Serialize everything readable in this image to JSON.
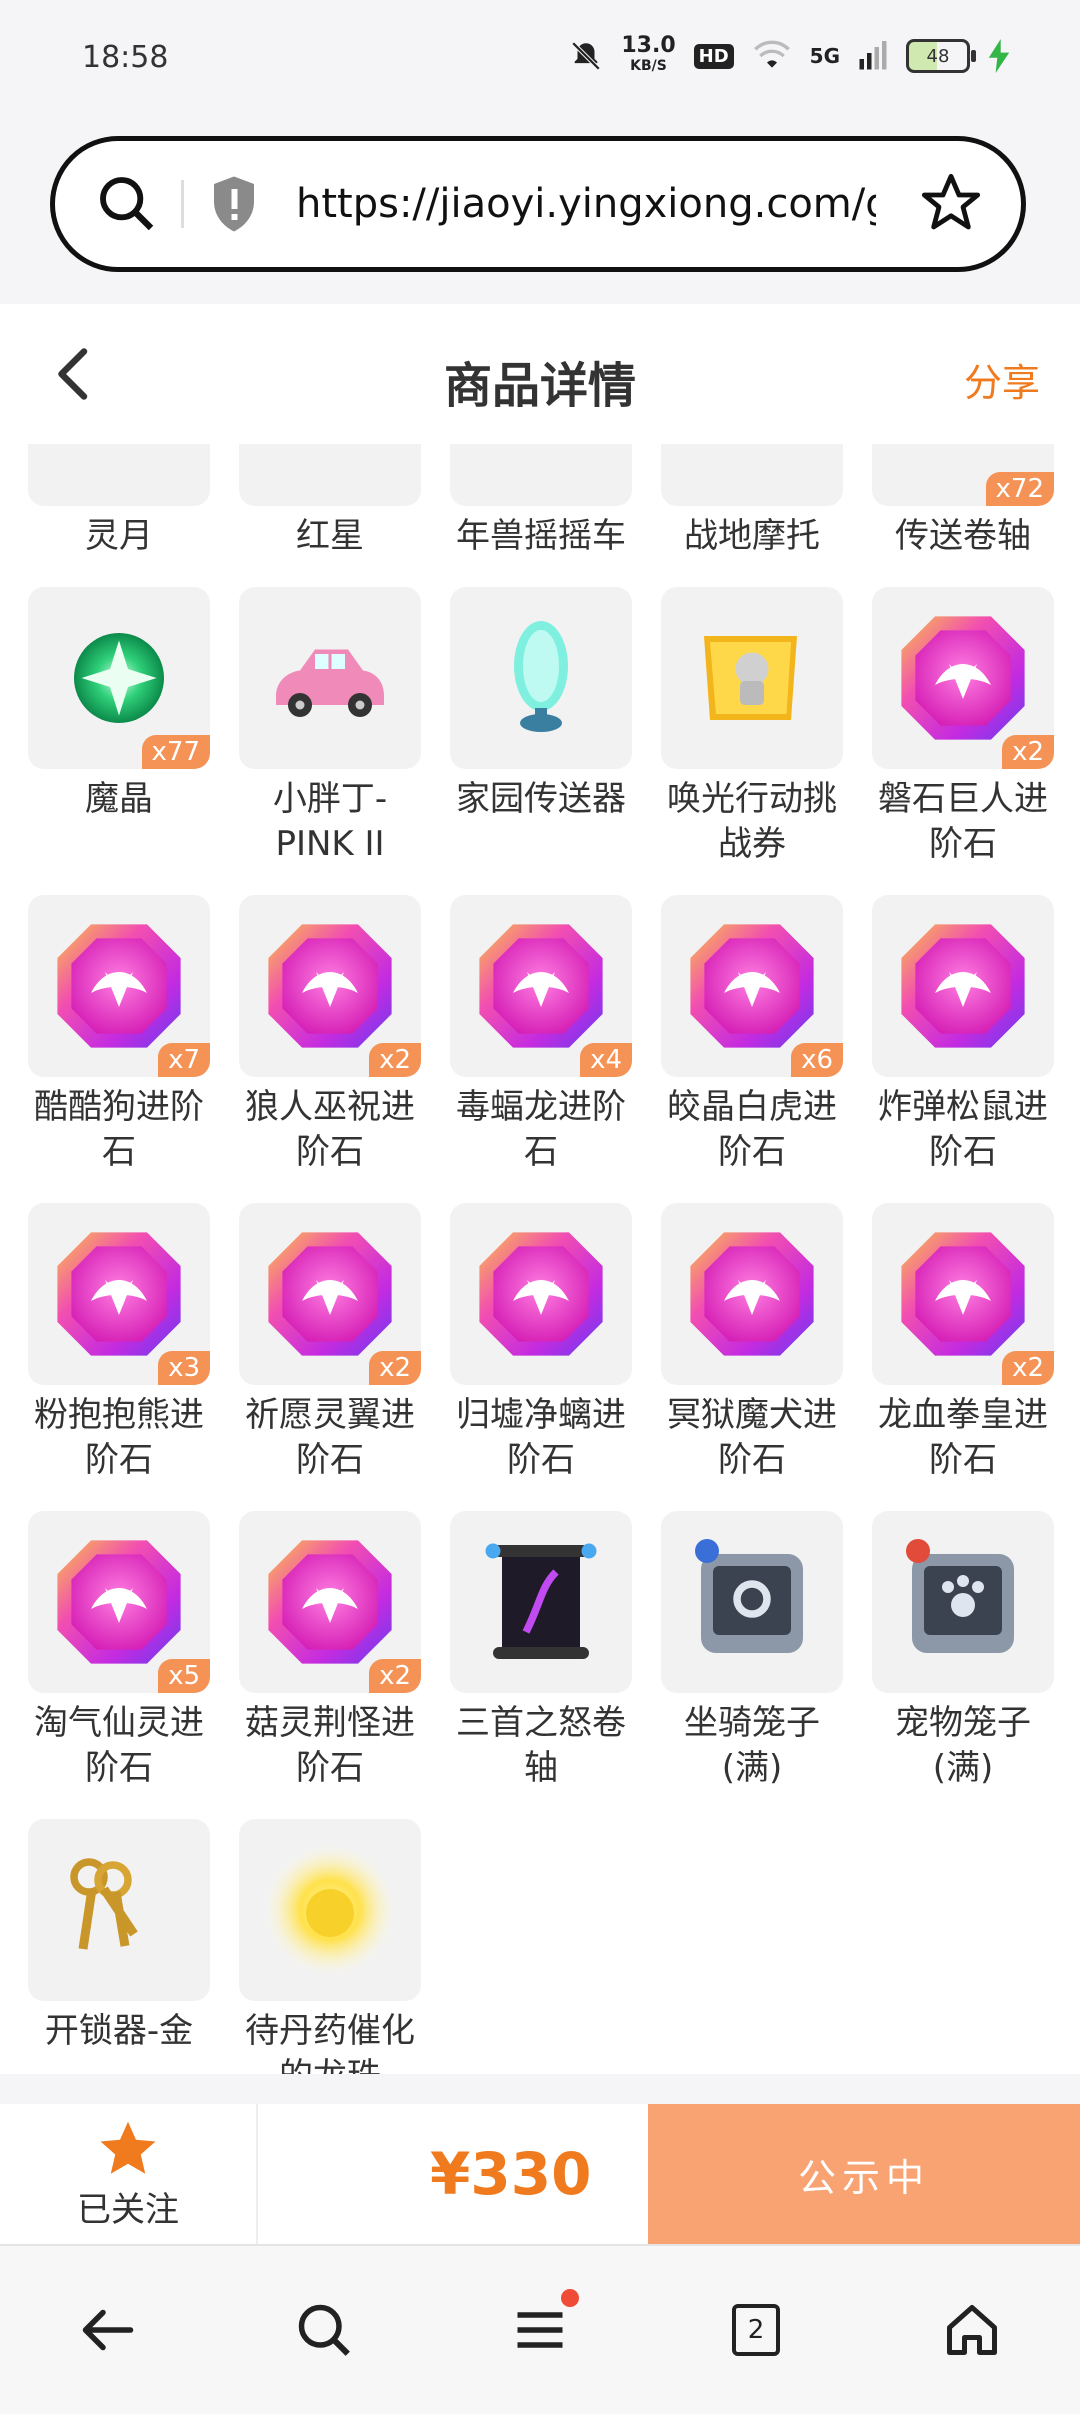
{
  "status": {
    "time": "18:58",
    "netspeed_value": "13.0",
    "netspeed_unit": "KB/S",
    "hd": "HD",
    "network": "5G",
    "battery": "48"
  },
  "browser": {
    "url": "https://jiaoyi.yingxiong.com/g ..."
  },
  "header": {
    "title": "商品详情",
    "share": "分享"
  },
  "items": [
    {
      "label": "灵月",
      "badge": "",
      "kind": "moon"
    },
    {
      "label": "红星",
      "badge": "",
      "kind": "ring"
    },
    {
      "label": "年兽摇摇车",
      "badge": "",
      "kind": "cart"
    },
    {
      "label": "战地摩托",
      "badge": "",
      "kind": "moto"
    },
    {
      "label": "传送卷轴",
      "badge": "x72",
      "kind": "scroll"
    },
    {
      "label": "魔晶",
      "badge": "x77",
      "kind": "crystal"
    },
    {
      "label": "小胖丁-PINK II",
      "badge": "",
      "kind": "car"
    },
    {
      "label": "家园传送器",
      "badge": "",
      "kind": "portal"
    },
    {
      "label": "唤光行动挑战券",
      "badge": "",
      "kind": "ticket"
    },
    {
      "label": "磐石巨人进阶石",
      "badge": "x2",
      "kind": "gem"
    },
    {
      "label": "酷酷狗进阶石",
      "badge": "x7",
      "kind": "gem"
    },
    {
      "label": "狼人巫祝进阶石",
      "badge": "x2",
      "kind": "gem"
    },
    {
      "label": "毒蝠龙进阶石",
      "badge": "x4",
      "kind": "gem"
    },
    {
      "label": "皎晶白虎进阶石",
      "badge": "x6",
      "kind": "gem"
    },
    {
      "label": "炸弹松鼠进阶石",
      "badge": "",
      "kind": "gem"
    },
    {
      "label": "粉抱抱熊进阶石",
      "badge": "x3",
      "kind": "gem"
    },
    {
      "label": "祈愿灵翼进阶石",
      "badge": "x2",
      "kind": "gem"
    },
    {
      "label": "归墟净螭进阶石",
      "badge": "",
      "kind": "gem"
    },
    {
      "label": "冥狱魔犬进阶石",
      "badge": "",
      "kind": "gem"
    },
    {
      "label": "龙血拳皇进阶石",
      "badge": "x2",
      "kind": "gem"
    },
    {
      "label": "淘气仙灵进阶石",
      "badge": "x5",
      "kind": "gem"
    },
    {
      "label": "菇灵荆怪进阶石",
      "badge": "x2",
      "kind": "gem"
    },
    {
      "label": "三首之怒卷轴",
      "badge": "",
      "kind": "darkscroll"
    },
    {
      "label": "坐骑笼子(满)",
      "badge": "",
      "kind": "cage"
    },
    {
      "label": "宠物笼子(满)",
      "badge": "",
      "kind": "cage-pet"
    },
    {
      "label": "开锁器-金",
      "badge": "",
      "kind": "keys"
    },
    {
      "label": "待丹药催化的龙珠",
      "badge": "",
      "kind": "orb"
    }
  ],
  "action": {
    "follow": "已关注",
    "price": "¥330",
    "notice": "公示中"
  },
  "nav": {
    "tabs": "2"
  }
}
